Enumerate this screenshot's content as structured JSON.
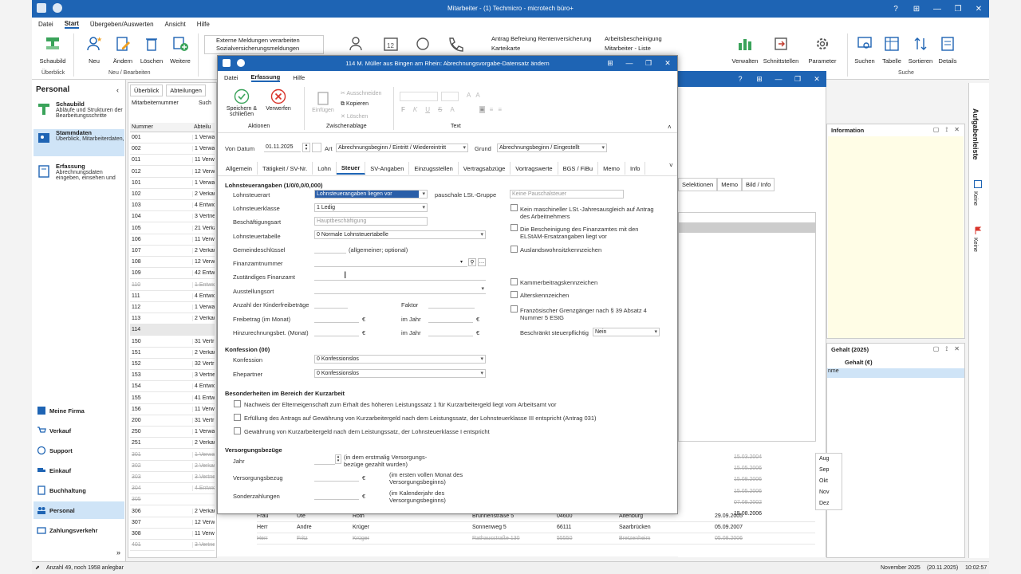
{
  "app": {
    "title": "Mitarbeiter - (1) Techmicro - microtech büro+",
    "menu": [
      "Datei",
      "Start",
      "Übergeben/Auswerten",
      "Ansicht",
      "Hilfe"
    ],
    "active_menu": "Start"
  },
  "ribbon": {
    "schaubild": "Schaubild",
    "group_ueberblick": "Überblick",
    "neu": "Neu",
    "aendern": "Ändern",
    "loeschen": "Löschen",
    "weitere": "Weitere",
    "group_neu": "Neu / Bearbeiten",
    "list1": [
      "Externe Meldungen verarbeiten",
      "Sozialversicherungsmeldungen"
    ],
    "list2": [
      "Antrag Befreiung Rentenversicherung",
      "Karteikarte"
    ],
    "list3": [
      "Arbeitsbescheinigung",
      "Mitarbeiter - Liste"
    ],
    "verwalten": "Verwalten",
    "schnittstellen": "Schnittstellen",
    "parameter": "Parameter",
    "suchen": "Suchen",
    "tabelle": "Tabelle",
    "sortieren": "Sortieren",
    "details": "Details",
    "group_suche": "Suche"
  },
  "sidebar": {
    "title": "Personal",
    "items": [
      {
        "title": "Schaubild",
        "desc": "Abläufe und Strukturen der Bearbeitungsschritte"
      },
      {
        "title": "Stammdaten",
        "desc": "Überblick, Mitarbeiterdaten,"
      },
      {
        "title": "Erfassung",
        "desc": "Abrechnungsdaten eingeben, einsehen und"
      }
    ],
    "nav": [
      "Meine Firma",
      "Verkauf",
      "Support",
      "Einkauf",
      "Buchhaltung",
      "Personal",
      "Zahlungsverkehr"
    ]
  },
  "list": {
    "tabs": [
      "Überblick",
      "Abteilungen"
    ],
    "header_filter": [
      "Mitarbeiternummer",
      "Such"
    ],
    "col_num": "Nummer",
    "col_abt": "Abteilu",
    "rows": [
      {
        "num": "001",
        "abt": "1 Verwa",
        "strike": false
      },
      {
        "num": "002",
        "abt": "1 Verwa",
        "strike": false
      },
      {
        "num": "011",
        "abt": "11 Verw",
        "strike": false
      },
      {
        "num": "012",
        "abt": "12 Verw",
        "strike": false
      },
      {
        "num": "101",
        "abt": "1 Verwa",
        "strike": false
      },
      {
        "num": "102",
        "abt": "2 Verkau",
        "strike": false
      },
      {
        "num": "103",
        "abt": "4 Entwic",
        "strike": false
      },
      {
        "num": "104",
        "abt": "3 Vertrie",
        "strike": false
      },
      {
        "num": "105",
        "abt": "21 Verka",
        "strike": false
      },
      {
        "num": "106",
        "abt": "11 Verw",
        "strike": false
      },
      {
        "num": "107",
        "abt": "2 Verkau",
        "strike": false
      },
      {
        "num": "108",
        "abt": "12 Verw",
        "strike": false
      },
      {
        "num": "109",
        "abt": "42 Entw",
        "strike": false
      },
      {
        "num": "110",
        "abt": "1 Entwic",
        "strike": true
      },
      {
        "num": "111",
        "abt": "4 Entwic",
        "strike": false
      },
      {
        "num": "112",
        "abt": "1 Verwa",
        "strike": false
      },
      {
        "num": "113",
        "abt": "2 Verkau",
        "strike": false
      },
      {
        "num": "114",
        "abt": "",
        "strike": false
      },
      {
        "num": "150",
        "abt": "31 Vertri",
        "strike": false
      },
      {
        "num": "151",
        "abt": "2 Verkau",
        "strike": false
      },
      {
        "num": "152",
        "abt": "32 Vertri",
        "strike": false
      },
      {
        "num": "153",
        "abt": "3 Vertrie",
        "strike": false
      },
      {
        "num": "154",
        "abt": "4 Entwic",
        "strike": false
      },
      {
        "num": "155",
        "abt": "41 Entwi",
        "strike": false
      },
      {
        "num": "156",
        "abt": "11 Verw",
        "strike": false
      },
      {
        "num": "200",
        "abt": "31 Vertri",
        "strike": false
      },
      {
        "num": "250",
        "abt": "1 Verwa",
        "strike": false
      },
      {
        "num": "251",
        "abt": "2 Verkau",
        "strike": false
      },
      {
        "num": "301",
        "abt": "1 Verwa",
        "strike": true
      },
      {
        "num": "302",
        "abt": "2 Verkau",
        "strike": true
      },
      {
        "num": "303",
        "abt": "3 Vertrie",
        "strike": true
      },
      {
        "num": "304",
        "abt": "4 Entwic",
        "strike": true
      },
      {
        "num": "305",
        "abt": "",
        "strike": true
      },
      {
        "num": "306",
        "abt": "2 Verkau",
        "strike": false
      },
      {
        "num": "307",
        "abt": "12 Verwaltung Leipzig",
        "strike": false
      },
      {
        "num": "308",
        "abt": "11 Verwaltung Saarbr...",
        "strike": false
      },
      {
        "num": "401",
        "abt": "3 Vertrieb",
        "strike": true
      }
    ],
    "bottom_rows": [
      {
        "anrede": "Frau",
        "vorname": "Ute",
        "name": "Roth",
        "strasse": "Brunnenstraße 5",
        "plz": "04600",
        "ort": "Altenburg",
        "datum": "29.09.2005"
      },
      {
        "anrede": "Herr",
        "vorname": "Andre",
        "name": "Krüger",
        "strasse": "Sonnenweg 5",
        "plz": "66111",
        "ort": "Saarbrücken",
        "datum": "05.09.2007"
      },
      {
        "anrede": "Herr",
        "vorname": "Fritz",
        "name": "Krüger",
        "strasse": "Rathausstraße 130",
        "plz": "55550",
        "ort": "Bretzenheim",
        "datum": "05.08.2006"
      }
    ],
    "dates_right": [
      "15.03.2004",
      "15.05.2006",
      "15.08.2006",
      "15.05.2006",
      "07.08.2002",
      "15.08.2006"
    ]
  },
  "right_panels": {
    "information": "Information",
    "gehalt_title": "Gehalt (2025)",
    "gehalt_col": "Gehalt (€)",
    "col_name": "nme",
    "months": [
      "Aug",
      "Sep",
      "Okt",
      "Nov",
      "Dez"
    ],
    "tabs2": [
      "Selektionen",
      "Memo",
      "Bild / Info"
    ],
    "aufgabenleiste": "Aufgabenleiste",
    "keine1": "Keine",
    "keine2": "Keine"
  },
  "status": {
    "left": "Anzahl 49, noch 1958 anlegbar",
    "period": "November 2025",
    "date": "(20.11.2025)",
    "time": "10:02:57"
  },
  "dialog": {
    "title": "114 M. Müller aus Bingen am Rhein: Abrechnungsvorgabe-Datensatz ändern",
    "menu": [
      "Datei",
      "Erfassung",
      "Hilfe"
    ],
    "active_menu": "Erfassung",
    "btn_save": "Speichern & schließen",
    "btn_discard": "Verwerfen",
    "group_aktionen": "Aktionen",
    "btn_einfuegen": "Einfügen",
    "btn_ausschneiden": "Ausschneiden",
    "btn_kopieren": "Kopieren",
    "btn_loeschen": "Löschen",
    "group_zwischenablage": "Zwischenablage",
    "group_text": "Text",
    "von_datum_label": "Von Datum",
    "von_datum": "01.11.2025",
    "art_label": "Art",
    "art": "Abrechnungsbeginn / Eintritt / Wiedereintritt",
    "grund_label": "Grund",
    "grund": "Abrechnungsbeginn / Eingestellt",
    "tabs": [
      "Allgemein",
      "Tätigkeit / SV-Nr.",
      "Lohn",
      "Steuer",
      "SV-Angaben",
      "Einzugsstellen",
      "Vertragsabzüge",
      "Vortragswerte",
      "BGS / FiBu",
      "Memo",
      "Info"
    ],
    "active_tab": "Steuer",
    "sect_lst": "Lohnsteuerangaben (1/0/0,0/0,000)",
    "lohnsteuerart_label": "Lohnsteuerart",
    "lohnsteuerart": "Lohnsteuerangaben liegen vor",
    "pauschale_label": "pauschale LSt.-Gruppe",
    "pauschale": "Keine Pauschalsteuer",
    "lohnsteuerklasse_label": "Lohnsteuerklasse",
    "lohnsteuerklasse": "1  Ledig",
    "beschaeftigungsart_label": "Beschäftigungsart",
    "beschaeftigungsart": "Hauptbeschäftigung",
    "lohnsteuertabelle_label": "Lohnsteuertabelle",
    "lohnsteuertabelle": "0 Normale Lohnsteuertabelle",
    "gemeinde_label": "Gemeindeschlüssel",
    "gemeinde_hint": "(allgemeiner; optional)",
    "finanzamtnr_label": "Finanzamtnummer",
    "zust_finanzamt_label": "Zuständiges Finanzamt",
    "ausstellungsort_label": "Ausstellungsort",
    "kinder_label": "Anzahl der Kinderfreibeträge",
    "faktor_label": "Faktor",
    "freibetrag_label": "Freibetrag (im Monat)",
    "hinzurechnung_label": "Hinzurechnungsbet. (Monat)",
    "im_jahr": "im Jahr",
    "euro": "€",
    "chk_right": [
      "Kein maschineller LSt.-Jahresausgleich auf Antrag des Arbeitnehmers",
      "Die Bescheinigung des Finanzamtes mit den ELStAM-Ersatzangaben liegt vor",
      "Auslandswohnsitzkennzeichen",
      "Kammerbeitragskennzeichen",
      "Alterskennzeichen",
      "Französischer Grenzgänger nach § 39 Absatz 4 Nummer 5 EStG"
    ],
    "beschraenkt_label": "Beschränkt steuerpflichtig",
    "beschraenkt": "Nein",
    "sect_konf": "Konfession (00)",
    "konfession_label": "Konfession",
    "konfession": "0  Konfessionslos",
    "ehepartner_label": "Ehepartner",
    "ehepartner": "0  Konfessionslos",
    "sect_kurz": "Besonderheiten im Bereich der Kurzarbeit",
    "kurz_chk": [
      "Nachweis der Elterneigenschaft zum Erhalt des höheren Leistungssatz 1  für Kurzarbeitergeld liegt vom Arbeitsamt vor",
      "Erfüllung des Antrags auf Gewährung von Kurzarbeitergeld nach dem Leistungssatz, der Lohnsteuerklasse III entspricht (Antrag 031)",
      "Gewährung von Kurzarbeitergeld nach dem Leistungssatz, der Lohnsteuerklasse I entspricht"
    ],
    "sect_versorg": "Versorgungsbezüge",
    "jahr_label": "Jahr",
    "jahr_hint": "(in dem erstmalig Versorgungs-bezüge gezahlt wurden)",
    "versorgungsbezug_label": "Versorgungsbezug",
    "versorgungsbezug_hint": "(im ersten vollen Monat des Versorgungsbeginns)",
    "sonder_label": "Sonderzahlungen",
    "sonder_hint": "(im Kalenderjahr des Versorgungsbeginns)"
  },
  "colors": {
    "accent": "#1e64b4",
    "selection": "#cfe4f7",
    "field_selected": "#2a5ea8"
  }
}
